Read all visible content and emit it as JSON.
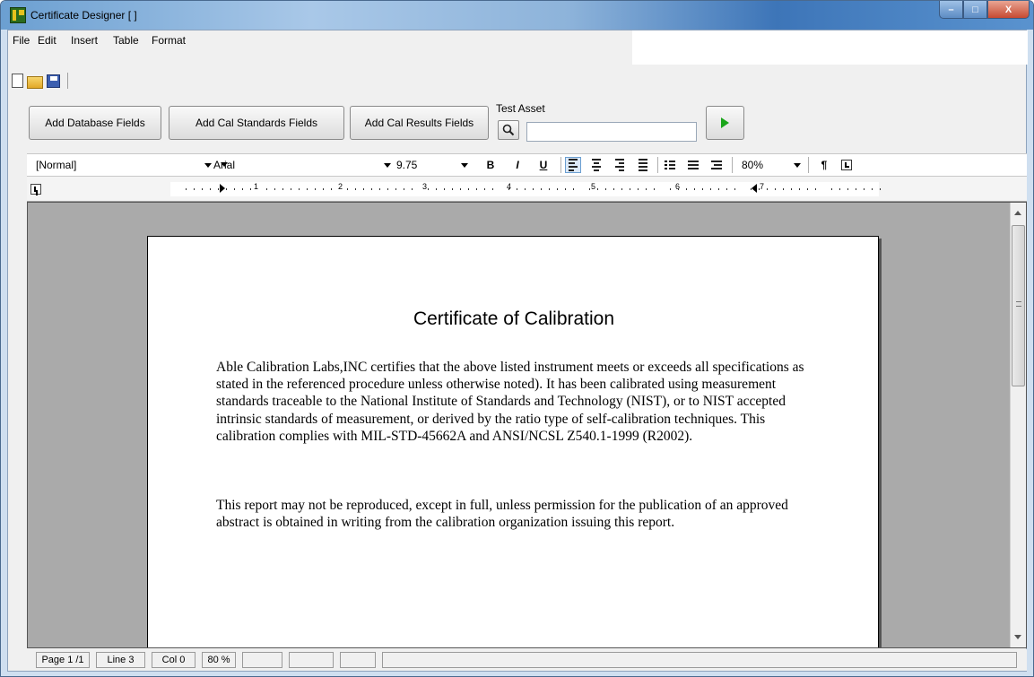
{
  "window": {
    "title": "Certificate Designer [ ]",
    "controls": {
      "minimize": "–",
      "maximize": "□",
      "close": "X"
    }
  },
  "menu": [
    {
      "label": "File"
    },
    {
      "label": "Edit"
    },
    {
      "label": "Insert"
    },
    {
      "label": "Table"
    },
    {
      "label": "Format"
    }
  ],
  "toolbar": {
    "icons": [
      "new-document-icon",
      "open-folder-icon",
      "save-disk-icon"
    ]
  },
  "actions": {
    "add_database_fields": "Add Database Fields",
    "add_cal_standards_fields": "Add Cal Standards Fields",
    "add_cal_results_fields": "Add Cal Results Fields",
    "test_asset_label": "Test Asset",
    "test_asset_value": "",
    "run_icon": "play-icon",
    "search_icon": "magnifier-icon"
  },
  "format": {
    "style": "[Normal]",
    "font": "Arial",
    "size": "9.75",
    "bold": "B",
    "italic": "I",
    "underline": "U",
    "zoom": "80%",
    "paragraph_mark": "¶"
  },
  "ruler": {
    "numbers": [
      "1",
      "2",
      "3",
      "4",
      "5",
      "6",
      "7"
    ]
  },
  "document": {
    "title": "Certificate of Calibration",
    "paragraph1": "Able Calibration Labs,INC certifies that the above listed  instrument meets or exceeds all specifications as stated in the referenced procedure  unless otherwise  noted). It has been calibrated using measurement standards traceable to the National Institute of Standards and Technology (NIST), or to NIST accepted intrinsic standards of measurement, or derived by the ratio type of self-calibration techniques. This calibration complies with MIL-STD-45662A and ANSI/NCSL Z540.1-1999 (R2002).",
    "paragraph2": "This report may not be reproduced, except in full, unless permission for the publication of an approved abstract is obtained in writing from the calibration organization issuing this report."
  },
  "status": {
    "page": "Page 1 /1",
    "line": "Line 3",
    "col": "Col 0",
    "zoom": "80 %"
  },
  "colors": {
    "titlebar": "#6b9fd1",
    "document_background": "#aaaaaa",
    "run_green": "#1aa51a"
  }
}
